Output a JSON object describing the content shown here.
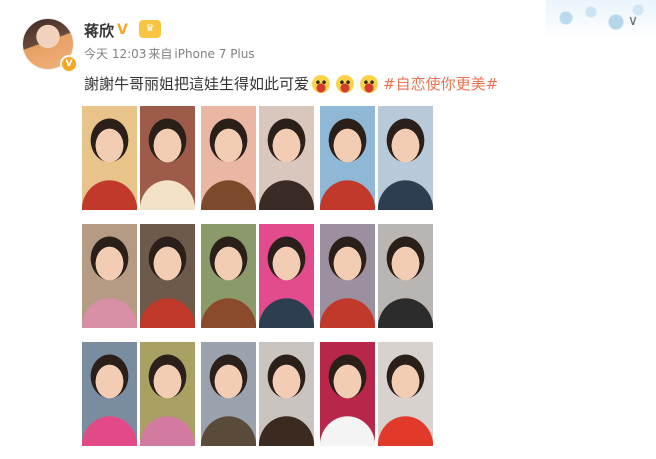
{
  "user": {
    "name": "蒋欣",
    "verified_icon": "verified-v-icon",
    "member_icon": "vip-crown-icon"
  },
  "meta": {
    "time": "今天 12:03",
    "source_prefix": "来自",
    "device": "iPhone 7 Plus"
  },
  "post": {
    "text": "謝謝牛哥丽姐把這娃生得如此可爱",
    "emoji_name": "surprised-face-icon",
    "emoji_count": 3,
    "hashtag": "#自恋使你更美#"
  },
  "colors": {
    "hashtag": "#eb7350",
    "verified": "#f5a623",
    "meta_text": "#808080"
  },
  "photos": [
    {
      "name": "photo-child-opera-costume",
      "bg": "#e8c48a",
      "fg": "#c0392b"
    },
    {
      "name": "photo-adult-period-costume",
      "bg": "#9e5b4a",
      "fg": "#f3e2c7"
    },
    {
      "name": "photo-child-bob-haircut",
      "bg": "#e9b7a4",
      "fg": "#7a4a2a"
    },
    {
      "name": "photo-adult-portrait-glasses",
      "bg": "#d9c7bd",
      "fg": "#3b2b25"
    },
    {
      "name": "photo-child-red-top",
      "bg": "#8fb8d6",
      "fg": "#c0392b"
    },
    {
      "name": "photo-adult-bangs-portrait",
      "bg": "#b8c9da",
      "fg": "#2c3e50"
    },
    {
      "name": "photo-child-pink-outfit-sitting",
      "bg": "#b59b84",
      "fg": "#d98fa5"
    },
    {
      "name": "photo-adult-red-dress-sitting",
      "bg": "#6e5a4a",
      "fg": "#c0392b"
    },
    {
      "name": "photo-child-headband-outdoors",
      "bg": "#8a9a6a",
      "fg": "#8b4a2b"
    },
    {
      "name": "photo-adult-leather-jacket-pink-bg",
      "bg": "#e24c8c",
      "fg": "#2c3e50"
    },
    {
      "name": "photo-child-smiling-lying",
      "bg": "#9c8fa0",
      "fg": "#c0392b"
    },
    {
      "name": "photo-adult-lying-pose",
      "bg": "#b9b5b2",
      "fg": "#2c2c2c"
    },
    {
      "name": "photo-child-martial-arts-pose",
      "bg": "#7a8ca0",
      "fg": "#e14a86"
    },
    {
      "name": "photo-adult-martial-arts-pose",
      "bg": "#a9a064",
      "fg": "#d37aa0"
    },
    {
      "name": "photo-child-bob-close-up",
      "bg": "#9aa3ad",
      "fg": "#5a4a3a"
    },
    {
      "name": "photo-adult-close-up",
      "bg": "#c9c4c0",
      "fg": "#3a2a20"
    },
    {
      "name": "photo-child-school-uniform-red-scarf",
      "bg": "#b8274a",
      "fg": "#f4f4f4"
    },
    {
      "name": "photo-adult-school-uniform-red-scarf",
      "bg": "#d7d2cd",
      "fg": "#e23a2a"
    }
  ]
}
